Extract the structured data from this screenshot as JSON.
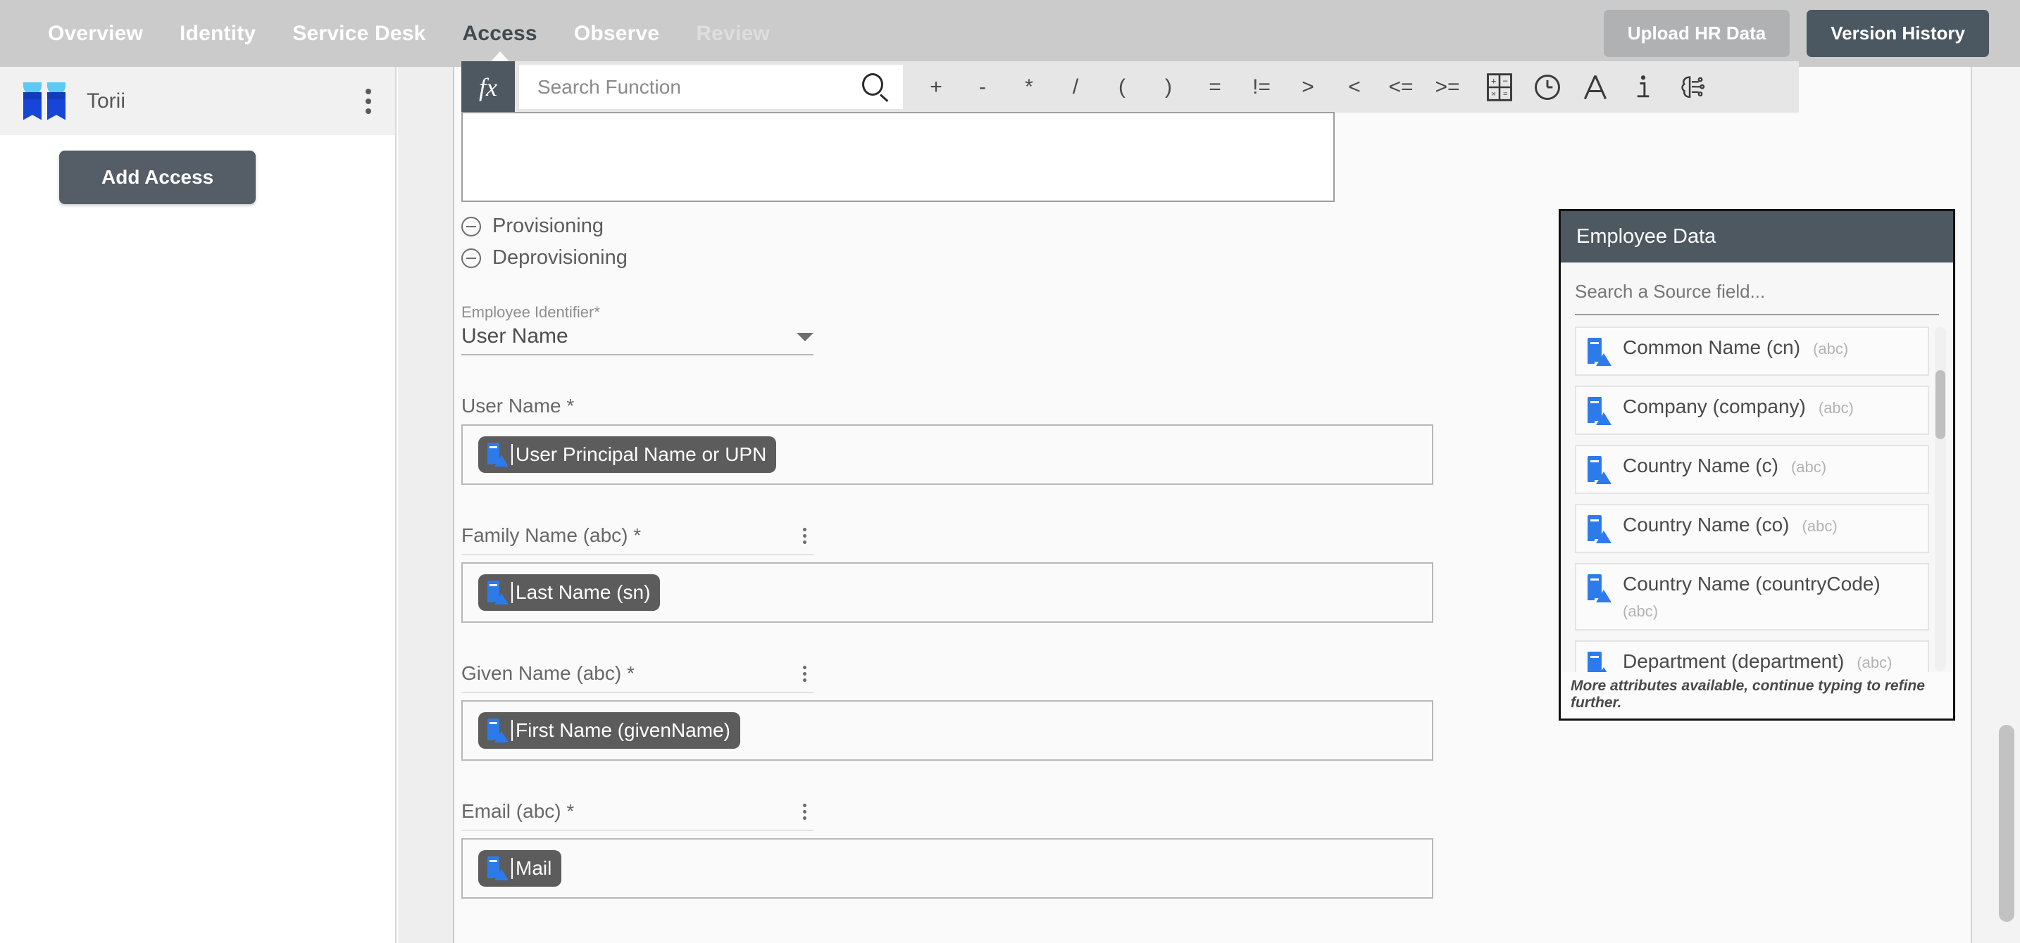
{
  "topnav": {
    "tabs": [
      {
        "label": "Overview",
        "state": "normal"
      },
      {
        "label": "Identity",
        "state": "normal"
      },
      {
        "label": "Service Desk",
        "state": "normal"
      },
      {
        "label": "Access",
        "state": "active"
      },
      {
        "label": "Observe",
        "state": "normal"
      },
      {
        "label": "Review",
        "state": "muted"
      }
    ],
    "upload_button": "Upload HR Data",
    "version_button": "Version History",
    "bg_color": "#cbcbcb",
    "active_color": "#414a4f",
    "version_button_color": "#4b5862",
    "upload_button_color": "#b0b1b3"
  },
  "sidebar": {
    "app_name": "Torii",
    "kebab_icon": "vertical-dots-icon",
    "add_access_button": "Add Access",
    "logo_colors": {
      "cap": "#5ec8f7",
      "body": "#1645d8"
    }
  },
  "toolbar": {
    "fx_label": "fx",
    "search_placeholder": "Search Function",
    "search_value": "",
    "search_icon": "magnifier-icon",
    "operators": [
      "+",
      "-",
      "*",
      "/",
      "(",
      ")",
      "=",
      "!=",
      ">",
      "<",
      "<=",
      ">="
    ],
    "icons": [
      {
        "name": "calculator-icon",
        "title": "Math functions"
      },
      {
        "name": "clock-icon",
        "title": "Date functions"
      },
      {
        "name": "text-a-icon",
        "title": "Text functions"
      },
      {
        "name": "info-icon",
        "title": "Info"
      },
      {
        "name": "brain-ai-icon",
        "title": "AI functions"
      }
    ],
    "fx_bg": "#4e5861"
  },
  "formula_editor": {
    "value": ""
  },
  "form": {
    "sections": [
      {
        "label": "Provisioning",
        "icon": "minus-circle-icon",
        "expanded": true
      },
      {
        "label": "Deprovisioning",
        "icon": "minus-circle-icon",
        "expanded": true
      }
    ],
    "employee_identifier": {
      "label": "Employee Identifier*",
      "value": "User Name",
      "caret_icon": "caret-down-icon"
    },
    "fields": [
      {
        "label": "User Name *",
        "has_kebab": false,
        "has_underline": false,
        "chip": {
          "text": "User Principal Name or UPN",
          "icon": "attribute-doc-icon"
        }
      },
      {
        "label": "Family Name (abc) *",
        "has_kebab": true,
        "has_underline": true,
        "chip": {
          "text": "Last Name (sn)",
          "icon": "attribute-doc-icon"
        }
      },
      {
        "label": "Given Name (abc) *",
        "has_kebab": true,
        "has_underline": true,
        "chip": {
          "text": "First Name (givenName)",
          "icon": "attribute-doc-icon"
        }
      },
      {
        "label": "Email (abc) *",
        "has_kebab": true,
        "has_underline": true,
        "chip": {
          "text": "Mail",
          "icon": "attribute-doc-icon"
        }
      }
    ]
  },
  "employee_data_panel": {
    "title": "Employee Data",
    "search_placeholder": "Search a Source field...",
    "search_value": "",
    "header_bg": "#4e5861",
    "items": [
      {
        "name": "Common Name (cn)",
        "type": "(abc)",
        "icon": "attribute-doc-icon",
        "wrap": false
      },
      {
        "name": "Company (company)",
        "type": "(abc)",
        "icon": "attribute-doc-icon",
        "wrap": false
      },
      {
        "name": "Country Name (c)",
        "type": "(abc)",
        "icon": "attribute-doc-icon",
        "wrap": false
      },
      {
        "name": "Country Name (co)",
        "type": "(abc)",
        "icon": "attribute-doc-icon",
        "wrap": false
      },
      {
        "name": "Country Name (countryCode)",
        "type": "(abc)",
        "icon": "attribute-doc-icon",
        "wrap": true
      },
      {
        "name": "Department (department)",
        "type": "(abc)",
        "icon": "attribute-doc-icon",
        "wrap": false
      }
    ],
    "footer_note": "More attributes available, continue typing to refine further."
  }
}
